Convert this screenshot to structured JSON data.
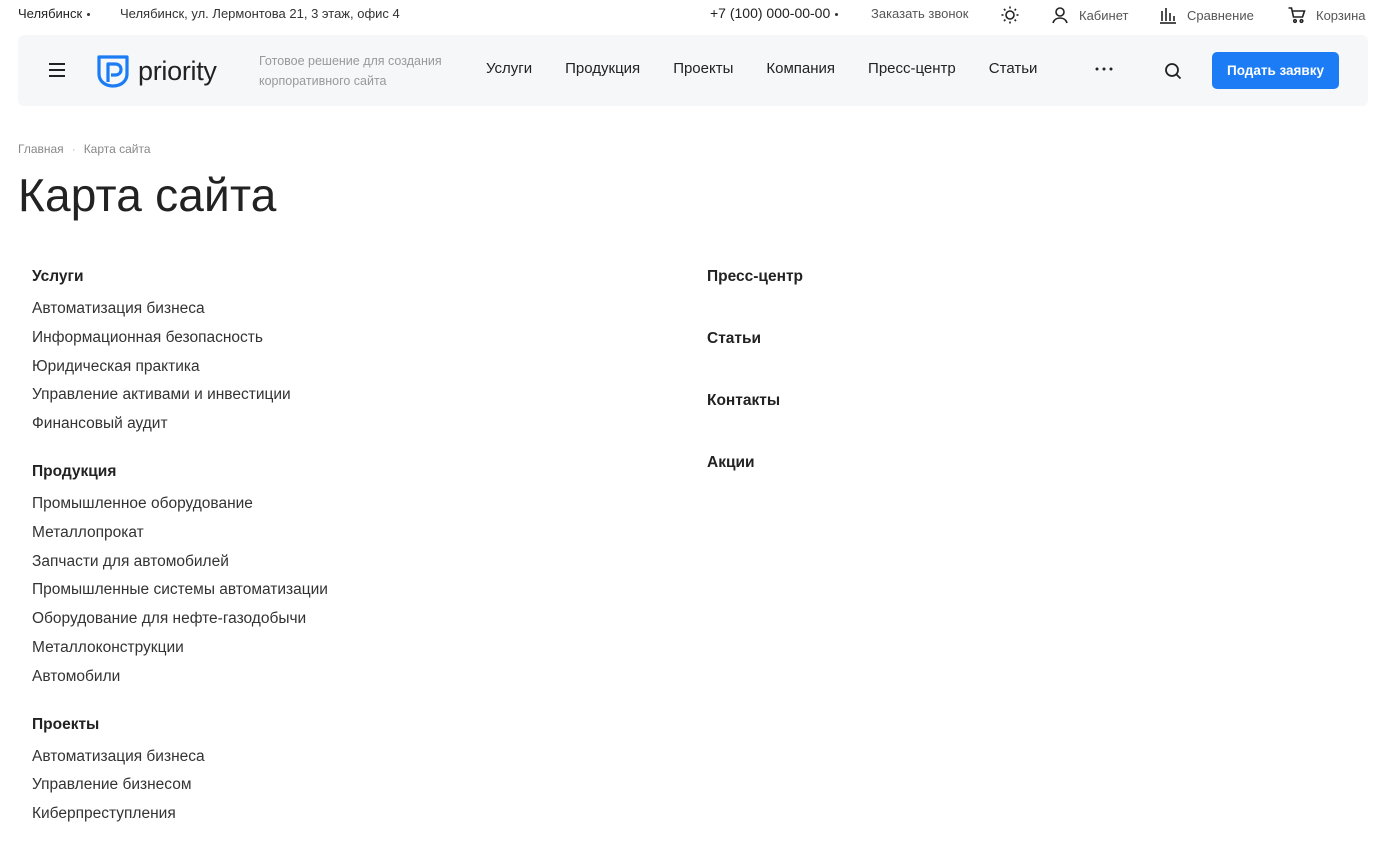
{
  "topbar": {
    "city": "Челябинск",
    "address": "Челябинск, ул. Лермонтова 21, 3 этаж, офис 4",
    "phone": "+7 (100) 000-00-00",
    "callback": "Заказать звонок",
    "cabinet": "Кабинет",
    "compare": "Сравнение",
    "cart": "Корзина"
  },
  "header": {
    "logo_text": "priority",
    "tagline_line1": "Готовое решение для создания",
    "tagline_line2": "корпоративного сайта",
    "nav": [
      "Услуги",
      "Продукция",
      "Проекты",
      "Компания",
      "Пресс-центр",
      "Статьи"
    ],
    "cta": "Подать заявку"
  },
  "breadcrumb": {
    "home": "Главная",
    "current": "Карта сайта"
  },
  "page_title": "Карта сайта",
  "sitemap": {
    "left": [
      {
        "title": "Услуги",
        "items": [
          "Автоматизация бизнеса",
          "Информационная безопасность",
          "Юридическая практика",
          "Управление активами и инвестиции",
          "Финансовый аудит"
        ]
      },
      {
        "title": "Продукция",
        "items": [
          "Промышленное оборудование",
          "Металлопрокат",
          "Запчасти для автомобилей",
          "Промышленные системы автоматизации",
          "Оборудование для нефте-газодобычи",
          "Металлоконструкции",
          "Автомобили"
        ]
      },
      {
        "title": "Проекты",
        "items": [
          "Автоматизация бизнеса",
          "Управление бизнесом",
          "Киберпреступления"
        ]
      }
    ],
    "right": [
      "Пресс-центр",
      "Статьи",
      "Контакты",
      "Акции"
    ]
  },
  "colors": {
    "accent": "#1b7cf5",
    "header_bg": "#f6f7f9",
    "text": "#222222",
    "muted": "#888888"
  }
}
